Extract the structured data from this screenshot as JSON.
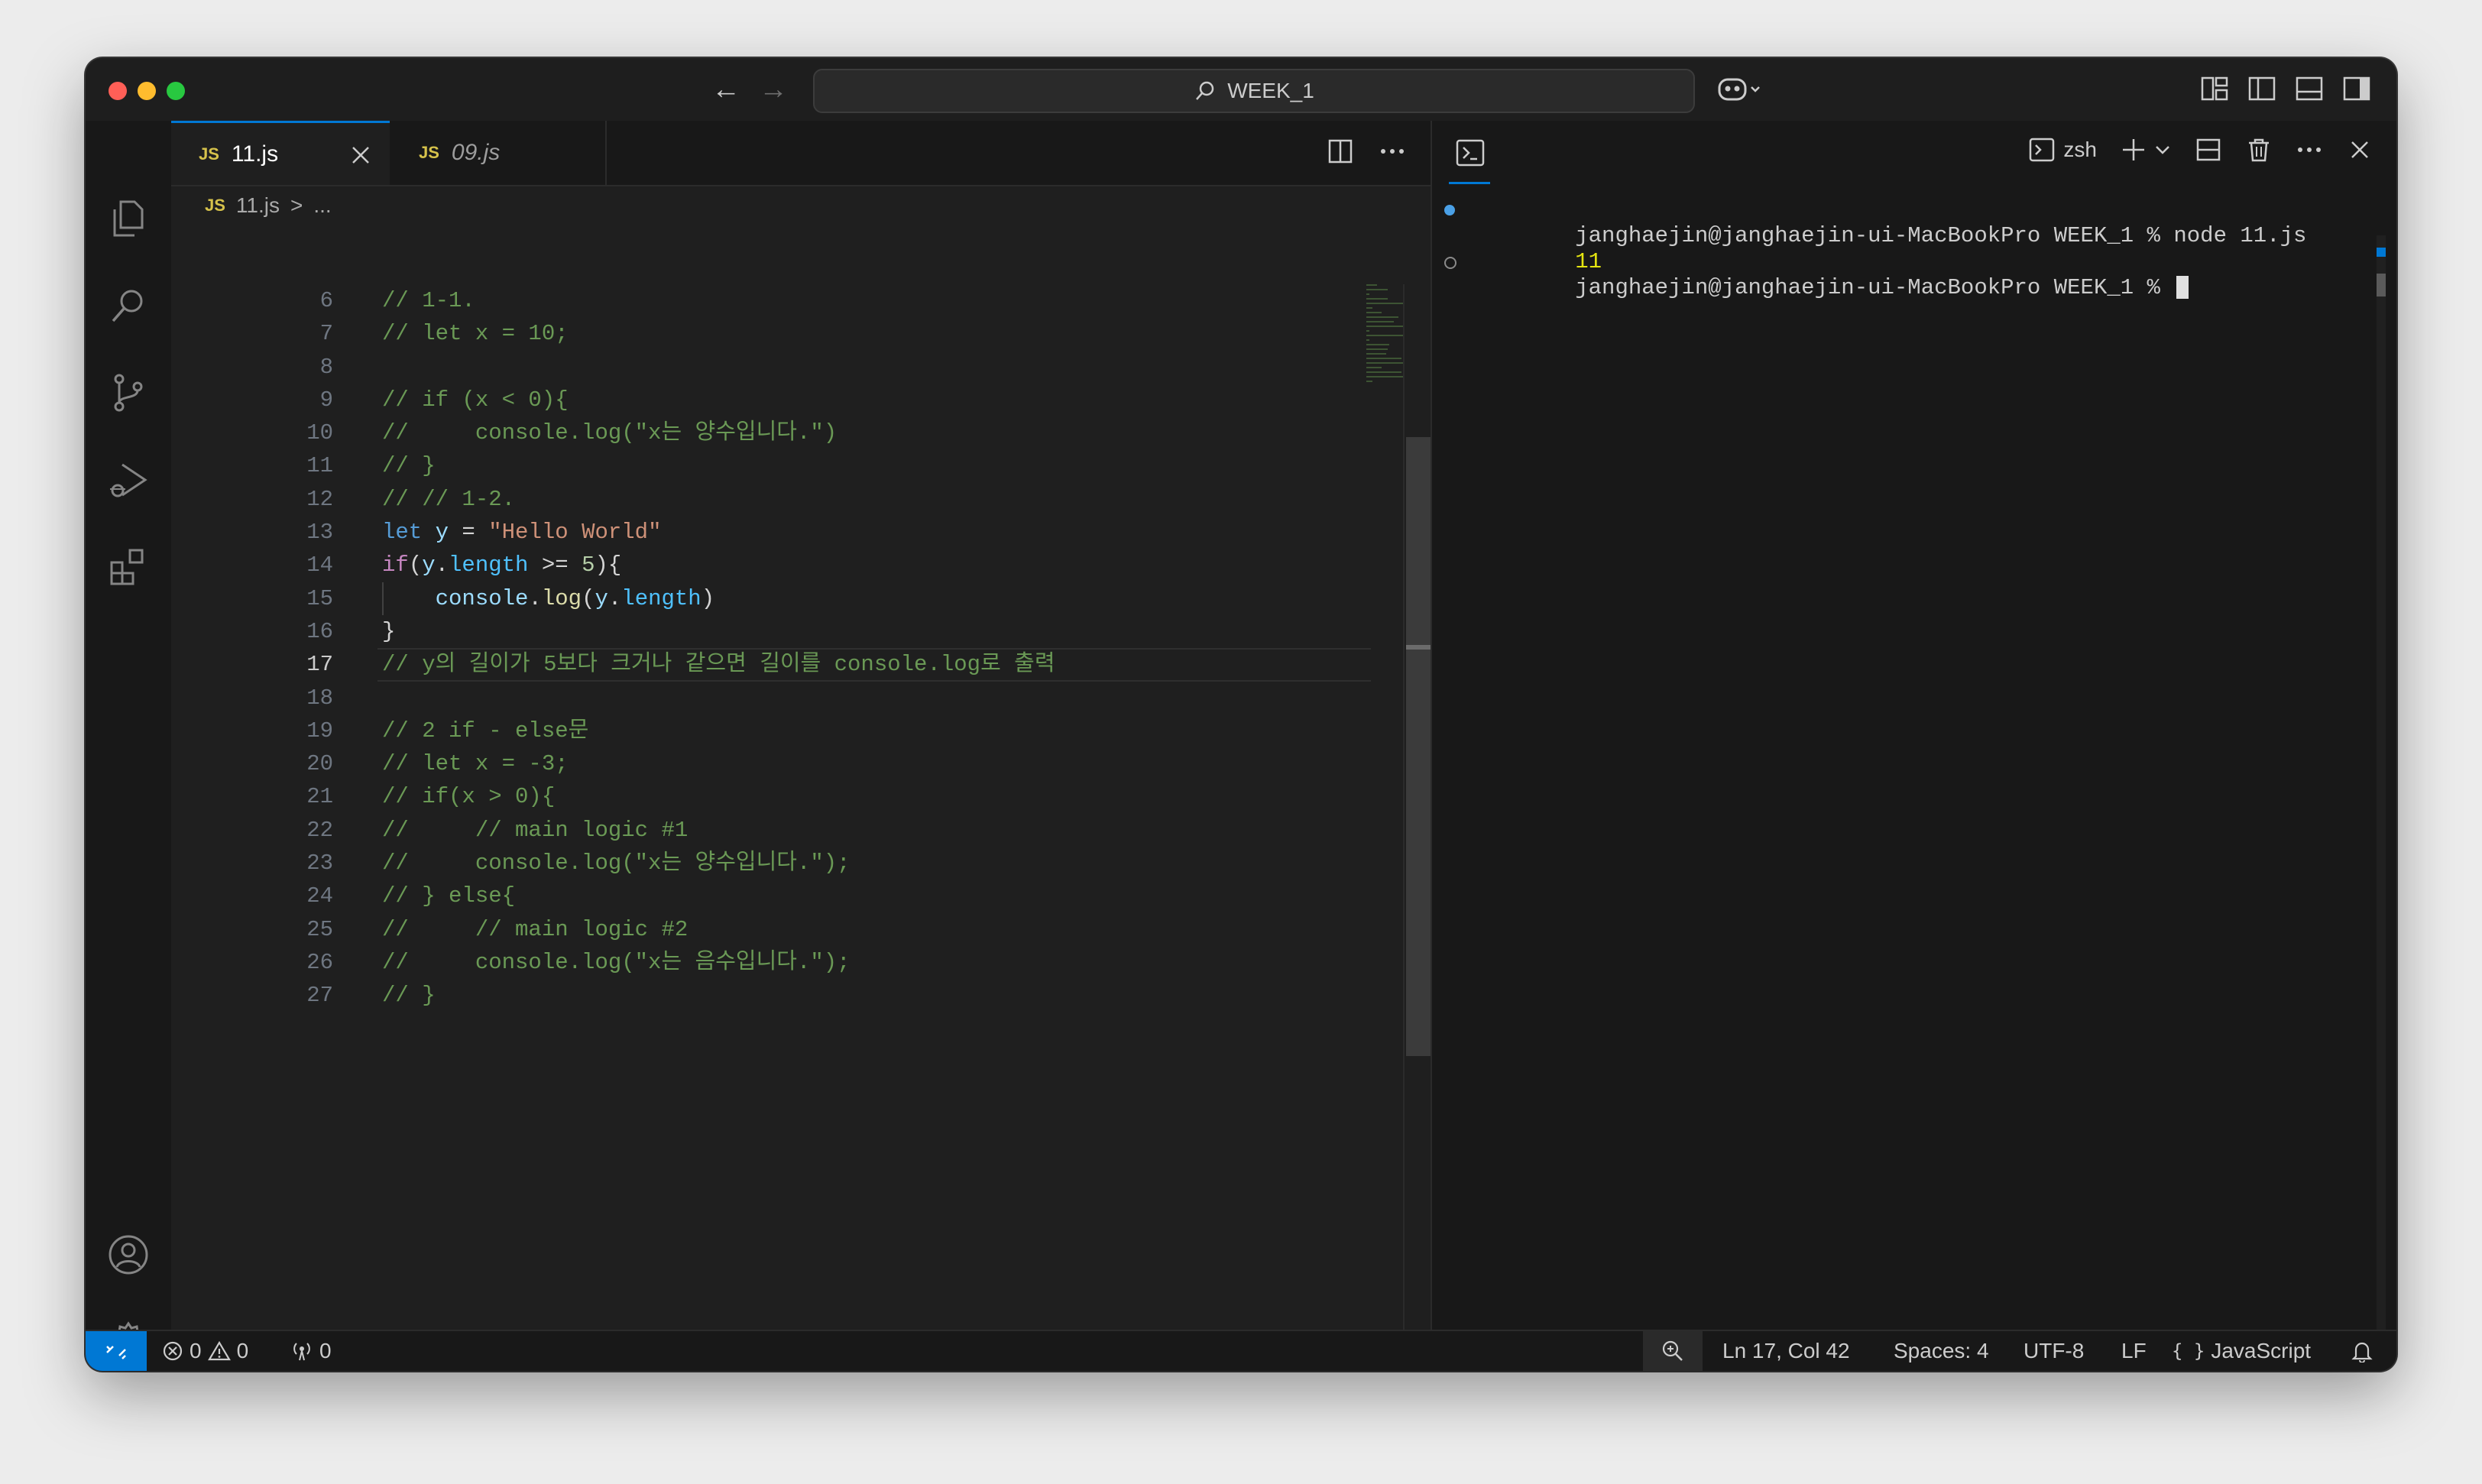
{
  "titlebar": {
    "search_text": "WEEK_1"
  },
  "tabs": [
    {
      "badge": "JS",
      "label": "11.js"
    },
    {
      "badge": "JS",
      "label": "09.js"
    }
  ],
  "breadcrumb": {
    "badge": "JS",
    "file": "11.js",
    "sep": ">",
    "rest": "..."
  },
  "editor": {
    "current_line": 17,
    "lines": [
      {
        "no": "6",
        "text": "// 1-1."
      },
      {
        "no": "7",
        "text": "// let x = 10;"
      },
      {
        "no": "8",
        "text": ""
      },
      {
        "no": "9",
        "text": "// if (x < 0){"
      },
      {
        "no": "10",
        "text": "//     console.log(\"x는 양수입니다.\")"
      },
      {
        "no": "11",
        "text": "// }"
      },
      {
        "no": "12",
        "text": "// // 1-2."
      },
      {
        "no": "13",
        "text": "let y = \"Hello World\""
      },
      {
        "no": "14",
        "text": "if(y.length >= 5){"
      },
      {
        "no": "15",
        "text": "    console.log(y.length)"
      },
      {
        "no": "16",
        "text": "}"
      },
      {
        "no": "17",
        "text": "// y의 길이가 5보다 크거나 같으면 길이를 console.log로 출력"
      },
      {
        "no": "18",
        "text": ""
      },
      {
        "no": "19",
        "text": "// 2 if - else문"
      },
      {
        "no": "20",
        "text": "// let x = -3;"
      },
      {
        "no": "21",
        "text": "// if(x > 0){"
      },
      {
        "no": "22",
        "text": "//     // main logic #1"
      },
      {
        "no": "23",
        "text": "//     console.log(\"x는 양수입니다.\");"
      },
      {
        "no": "24",
        "text": "// } else{"
      },
      {
        "no": "25",
        "text": "//     // main logic #2"
      },
      {
        "no": "26",
        "text": "//     console.log(\"x는 음수입니다.\");"
      },
      {
        "no": "27",
        "text": "// }"
      }
    ]
  },
  "terminal": {
    "shell_label": "zsh",
    "lines": [
      {
        "status": "done",
        "text": "janghaejin@janghaejin-ui-MacBookPro WEEK_1 % node 11.js"
      },
      {
        "status": "output",
        "text": "11"
      },
      {
        "status": "prompt",
        "text": "janghaejin@janghaejin-ui-MacBookPro WEEK_1 % "
      }
    ]
  },
  "statusbar": {
    "errors": "0",
    "warnings": "0",
    "ports": "0",
    "position": "Ln 17, Col 42",
    "spaces": "Spaces: 4",
    "encoding": "UTF-8",
    "eol": "LF",
    "language": "JavaScript"
  },
  "colors": {
    "accent": "#0078d4",
    "comment": "#6a9955",
    "string": "#ce9178",
    "keyword": "#c586c0",
    "variable": "#9cdcfe",
    "terminal_output": "#e5e510"
  },
  "icons": {
    "activity": [
      "explorer-icon",
      "search-icon",
      "source-control-icon",
      "run-debug-icon",
      "extensions-icon",
      "account-icon",
      "settings-gear-icon"
    ]
  }
}
